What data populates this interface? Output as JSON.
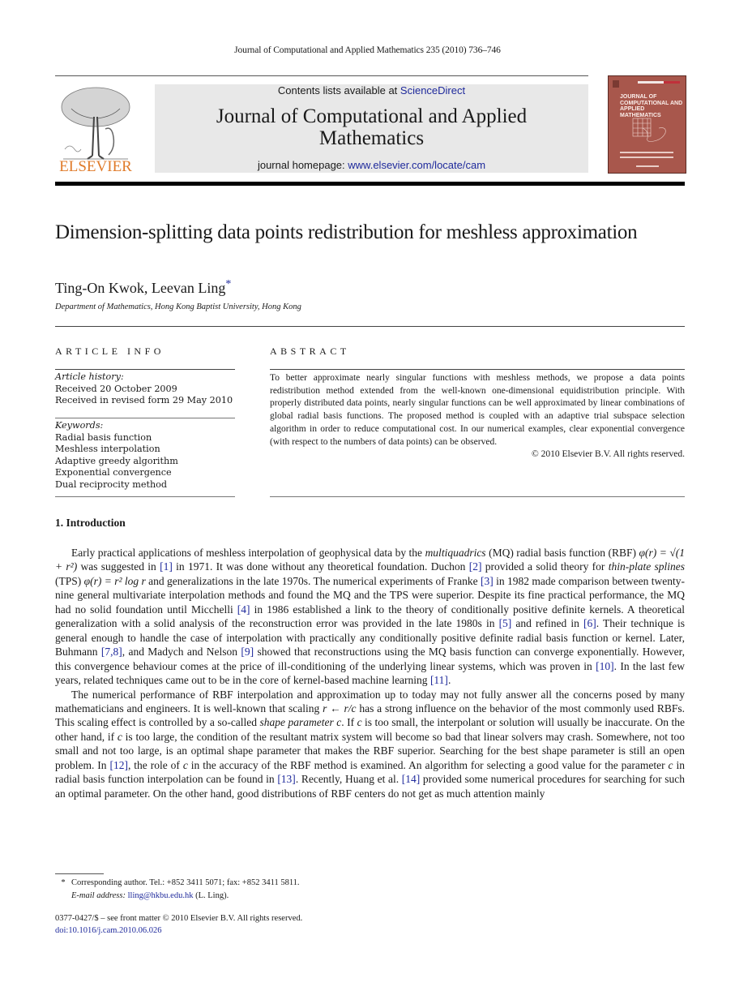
{
  "running_head": "Journal of Computational and Applied Mathematics 235 (2010) 736–746",
  "banner": {
    "contents_prefix": "Contents lists available at ",
    "contents_link": "ScienceDirect",
    "journal_title_line1": "Journal of Computational and Applied",
    "journal_title_line2": "Mathematics",
    "homepage_prefix": "journal homepage: ",
    "homepage_link": "www.elsevier.com/locate/cam"
  },
  "publisher_logo": {
    "name": "ELSEVIER",
    "color": "#e07b2a"
  },
  "cover": {
    "title_line1": "JOURNAL OF",
    "title_line2": "COMPUTATIONAL AND",
    "title_line3": "APPLIED MATHEMATICS",
    "color": "#a8574c"
  },
  "article": {
    "title": "Dimension-splitting data points redistribution for meshless approximation",
    "authors": "Ting-On Kwok, Leevan Ling",
    "author_mark": "*",
    "affiliation": "Department of Mathematics, Hong Kong Baptist University, Hong Kong"
  },
  "article_info": {
    "heading": "ARTICLE INFO",
    "history_label": "Article history:",
    "history": [
      "Received 20 October 2009",
      "Received in revised form 29 May 2010"
    ],
    "keywords_label": "Keywords:",
    "keywords": [
      "Radial basis function",
      "Meshless interpolation",
      "Adaptive greedy algorithm",
      "Exponential convergence",
      "Dual reciprocity method"
    ]
  },
  "abstract": {
    "heading": "ABSTRACT",
    "text": "To better approximate nearly singular functions with meshless methods, we propose a data points redistribution method extended from the well-known one-dimensional equidistribution principle. With properly distributed data points, nearly singular functions can be well approximated by linear combinations of global radial basis functions. The proposed method is coupled with an adaptive trial subspace selection algorithm in order to reduce computational cost. In our numerical examples, clear exponential convergence (with respect to the numbers of data points) can be observed.",
    "copyright": "© 2010 Elsevier B.V. All rights reserved."
  },
  "section1": {
    "heading": "1.  Introduction",
    "p1": {
      "a": "Early practical applications of meshless interpolation of geophysical data by the ",
      "b_italic": "multiquadrics",
      "c": " (MQ) radial basis function (RBF) ",
      "formula1": "φ(r) = √(1 + r²)",
      "d": " was suggested in ",
      "ref1": "[1]",
      "e": " in 1971. It was done without any theoretical foundation. Duchon ",
      "ref2": "[2]",
      "f": " provided a solid theory for ",
      "g_italic": "thin-plate splines",
      "h": " (TPS) ",
      "formula2": "φ(r) = r² log r",
      "i": " and generalizations in the late 1970s. The numerical experiments of Franke ",
      "ref3": "[3]",
      "j": " in 1982 made comparison between twenty-nine general multivariate interpolation methods and found the MQ and the TPS were superior. Despite its fine practical performance, the MQ had no solid foundation until Micchelli ",
      "ref4": "[4]",
      "k": " in 1986 established a link to the theory of conditionally positive definite kernels. A theoretical generalization with a solid analysis of the reconstruction error was provided in the late 1980s in ",
      "ref5": "[5]",
      "l": " and refined in ",
      "ref6": "[6]",
      "m": ". Their technique is general enough to handle the case of interpolation with practically any conditionally positive definite radial basis function or kernel. Later, Buhmann ",
      "ref78": "[7,8]",
      "n": ", and Madych and Nelson ",
      "ref9": "[9]",
      "o": " showed that reconstructions using the MQ basis function can converge exponentially. However, this convergence behaviour comes at the price of ill-conditioning of the underlying linear systems, which was proven in ",
      "ref10": "[10]",
      "p": ". In the last few years, related techniques came out to be in the core of kernel-based machine learning ",
      "ref11": "[11]",
      "q": "."
    },
    "p2": {
      "a": "The numerical performance of RBF interpolation and approximation up to today may not fully answer all the concerns posed by many mathematicians and engineers. It is well-known that scaling ",
      "formula": "r ← r/c",
      "b": " has a strong influence on the behavior of the most commonly used RBFs. This scaling effect is controlled by a so-called ",
      "c_italic": "shape parameter c",
      "d": ". If ",
      "c1": "c",
      "e": " is too small, the interpolant or solution will usually be inaccurate. On the other hand, if ",
      "c2": "c",
      "f": " is too large, the condition of the resultant matrix system will become so bad that linear solvers may crash. Somewhere, not too small and not too large, is an optimal shape parameter that makes the RBF superior. Searching for the best shape parameter is still an open problem. In ",
      "ref12": "[12]",
      "g": ", the role of ",
      "c3": "c",
      "h": " in the accuracy of the RBF method is examined. An algorithm for selecting a good value for the parameter ",
      "c4": "c",
      "i": " in radial basis function interpolation can be found in ",
      "ref13": "[13]",
      "j": ". Recently, Huang et al. ",
      "ref14": "[14]",
      "k": " provided some numerical procedures for searching for such an optimal parameter. On the other hand, good distributions of RBF centers do not get as much attention mainly"
    }
  },
  "footnote": {
    "mark": "*",
    "text": "Corresponding author. Tel.: +852 3411 5071; fax: +852 3411 5811.",
    "email_label": "E-mail address: ",
    "email": "lling@hkbu.edu.hk",
    "email_suffix": " (L. Ling)."
  },
  "front_matter": {
    "issn": "0377-0427/$ – see front matter © 2010 Elsevier B.V. All rights reserved.",
    "doi": "doi:10.1016/j.cam.2010.06.026"
  }
}
